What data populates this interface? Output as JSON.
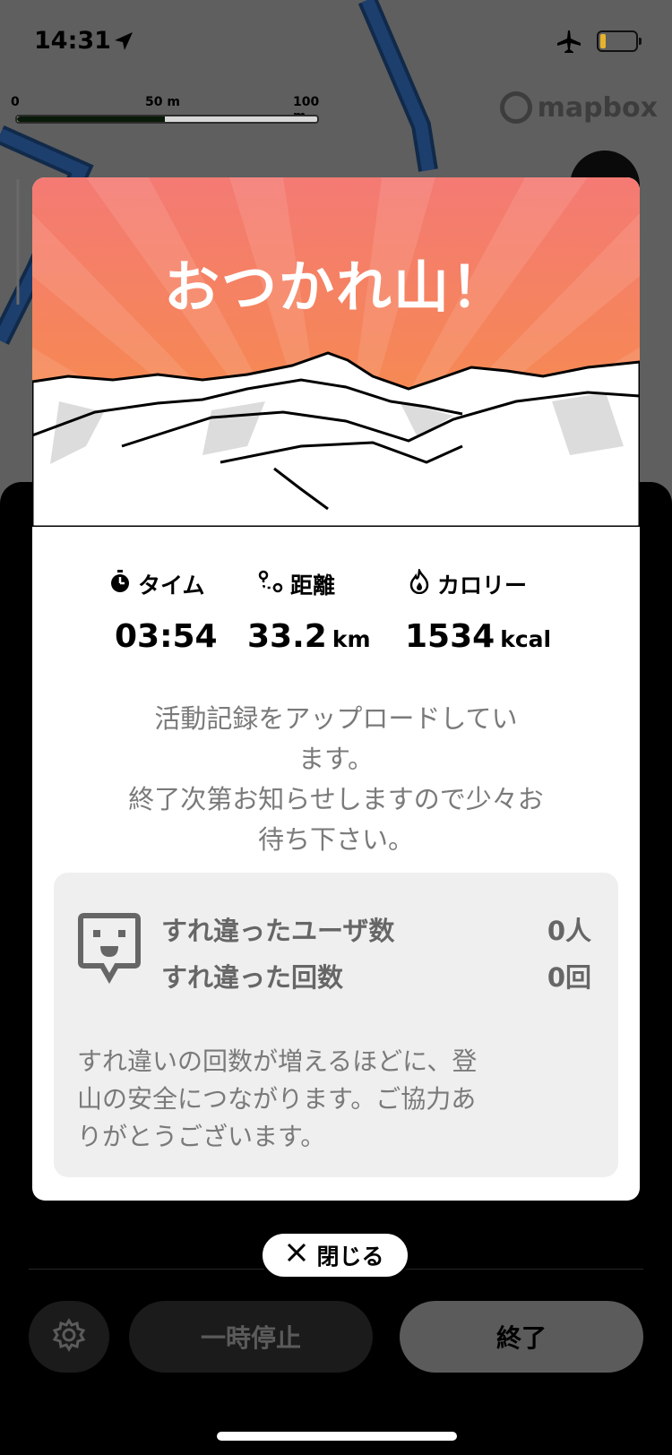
{
  "status_bar": {
    "time": "14:31"
  },
  "map": {
    "scale": {
      "tick_0": "0",
      "tick_mid": "50 m",
      "tick_end": "100 m",
      "fill_fraction": 0.5
    },
    "attribution": "mapbox"
  },
  "modal": {
    "title": "おつかれ山！",
    "stats": {
      "time_label": "タイム",
      "time_value": "03:54",
      "distance_label": "距離",
      "distance_value": "33.2",
      "distance_unit": "km",
      "calorie_label": "カロリー",
      "calorie_value": "1534",
      "calorie_unit": "kcal"
    },
    "upload_message": [
      "活動記録をアップロードしてい",
      "ます。",
      "終了次第お知らせしますので少々お",
      "待ち下さい。"
    ],
    "encounter": {
      "users_label": "すれ違ったユーザ数",
      "users_value": "0人",
      "count_label": "すれ違った回数",
      "count_value": "0回",
      "note": [
        "すれ違いの回数が増えるほどに、登",
        "山の安全につながります。ご協力あ",
        "りがとうございます。"
      ]
    }
  },
  "close_button": {
    "label": "閉じる"
  },
  "controls": {
    "pause_label": "一時停止",
    "end_label": "終了"
  },
  "colors": {
    "hero_top": "#f47a74",
    "hero_bottom": "#f7923e",
    "map_route": "#1d3f6e"
  },
  "icons": [
    "location-arrow-icon",
    "airplane-icon",
    "battery-icon",
    "stopwatch-icon",
    "route-icon",
    "flame-icon",
    "encounter-face-icon",
    "close-icon",
    "gear-icon"
  ]
}
